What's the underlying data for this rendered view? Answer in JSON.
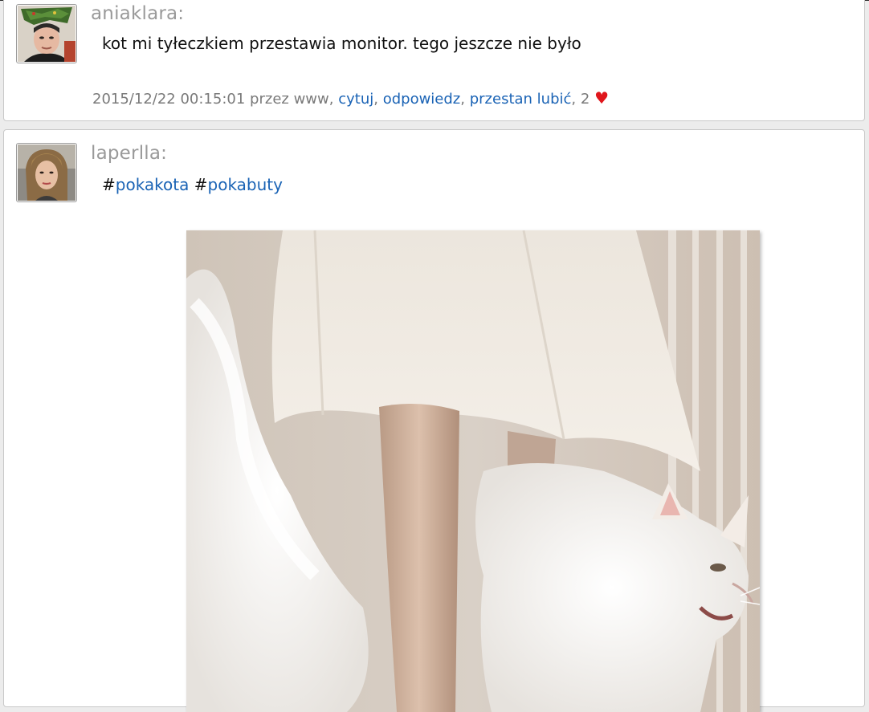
{
  "posts": [
    {
      "username": "aniaklara:",
      "message": "kot mi tyłeczkiem przestawia monitor. tego jeszcze nie było",
      "meta": {
        "datetime": "2015/12/22 00:15:01",
        "via_prefix": "przez",
        "via": "www",
        "sep": ",",
        "quote_label": "cytuj",
        "reply_label": "odpowiedz",
        "unlike_label": "przestan lubić",
        "likes_count": "2",
        "heart": "♥"
      },
      "avatar_icon": "user-avatar-photo"
    },
    {
      "username": "laperlla:",
      "hashtags": [
        {
          "hash": "#",
          "tag": "pokakota"
        },
        {
          "hash": "#",
          "tag": "pokabuty"
        }
      ],
      "avatar_icon": "user-avatar-photo",
      "image_icon": "white-cat-and-skirt-photo"
    }
  ],
  "colors": {
    "link": "#1a63b5",
    "username": "#9a9a9a",
    "meta": "#7a7a7a",
    "heart": "#e0161c"
  }
}
